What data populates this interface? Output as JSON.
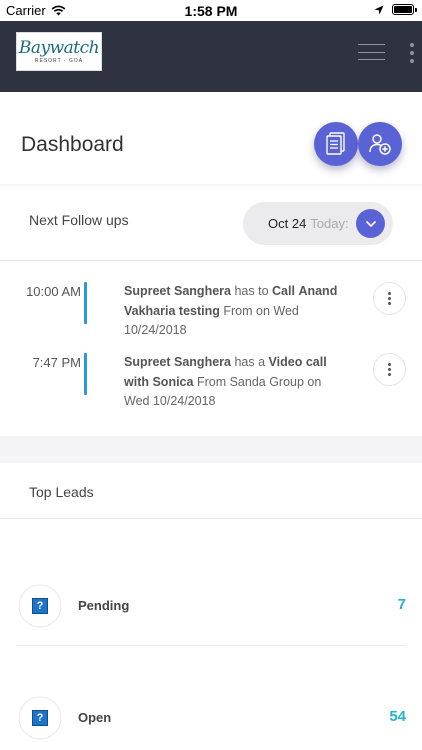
{
  "status_bar": {
    "carrier": "Carrier",
    "time": "1:58 PM"
  },
  "header": {
    "logo_text": "Baywatch",
    "logo_subtext": "RESORT · GOA"
  },
  "dashboard": {
    "title": "Dashboard"
  },
  "followups": {
    "title": "Next Follow ups",
    "date": "Oct 24",
    "today_label": "Today:",
    "items": [
      {
        "time": "10:00 AM",
        "user": "Supreet Sanghera",
        "connector": "has to",
        "action": "Call",
        "target": "Anand Vakharia testing",
        "from_text": "From on",
        "date": "Wed 10/24/2018"
      },
      {
        "time": "7:47 PM",
        "user": "Supreet Sanghera",
        "connector": "has a",
        "action": "Video call",
        "target": "with Sonica",
        "from_text": "From Sanda Group on",
        "date": "Wed 10/24/2018"
      }
    ]
  },
  "leads": {
    "title": "Top Leads",
    "rows": [
      {
        "label": "Pending",
        "count": "7"
      },
      {
        "label": "Open",
        "count": "54"
      }
    ]
  },
  "colors": {
    "header_bg": "#2e3241",
    "accent": "#5a63d6",
    "timeline_bar": "#2a97e0",
    "count": "#25b3d1"
  }
}
